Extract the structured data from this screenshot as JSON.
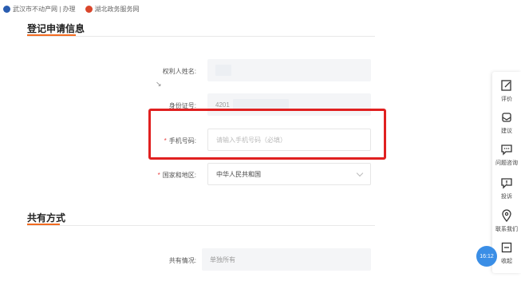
{
  "topbar": {
    "links": [
      {
        "label": "武汉市不动产网 | 办理"
      },
      {
        "label": "湖北政务服务网"
      }
    ]
  },
  "sections": {
    "registration": {
      "title": "登记申请信息"
    },
    "co_ownership": {
      "title": "共有方式"
    }
  },
  "form": {
    "owner_name": {
      "label": "权利人姓名:",
      "value": ""
    },
    "id_number": {
      "label": "身份证号:",
      "value": "4201"
    },
    "phone": {
      "label": "手机号码:",
      "placeholder": "请输入手机号码（必填）",
      "required": true
    },
    "region": {
      "label": "国家和地区:",
      "value": "中华人民共和国",
      "required": true
    },
    "co_ownership": {
      "label": "共有情况:",
      "value": "单独所有"
    }
  },
  "sidebar": {
    "items": [
      {
        "label": "评价",
        "icon": "edit-icon"
      },
      {
        "label": "建议",
        "icon": "mailbox-icon"
      },
      {
        "label": "问题咨询",
        "icon": "chat-icon"
      },
      {
        "label": "投诉",
        "icon": "alert-icon"
      },
      {
        "label": "联系我们",
        "icon": "location-icon"
      },
      {
        "label": "收起",
        "icon": "collapse-icon"
      }
    ]
  },
  "clock": {
    "time": "16:12"
  },
  "colors": {
    "accent": "#f26b21",
    "highlight": "#e02020",
    "required": "#e94040",
    "clock": "#3a8ee6"
  }
}
